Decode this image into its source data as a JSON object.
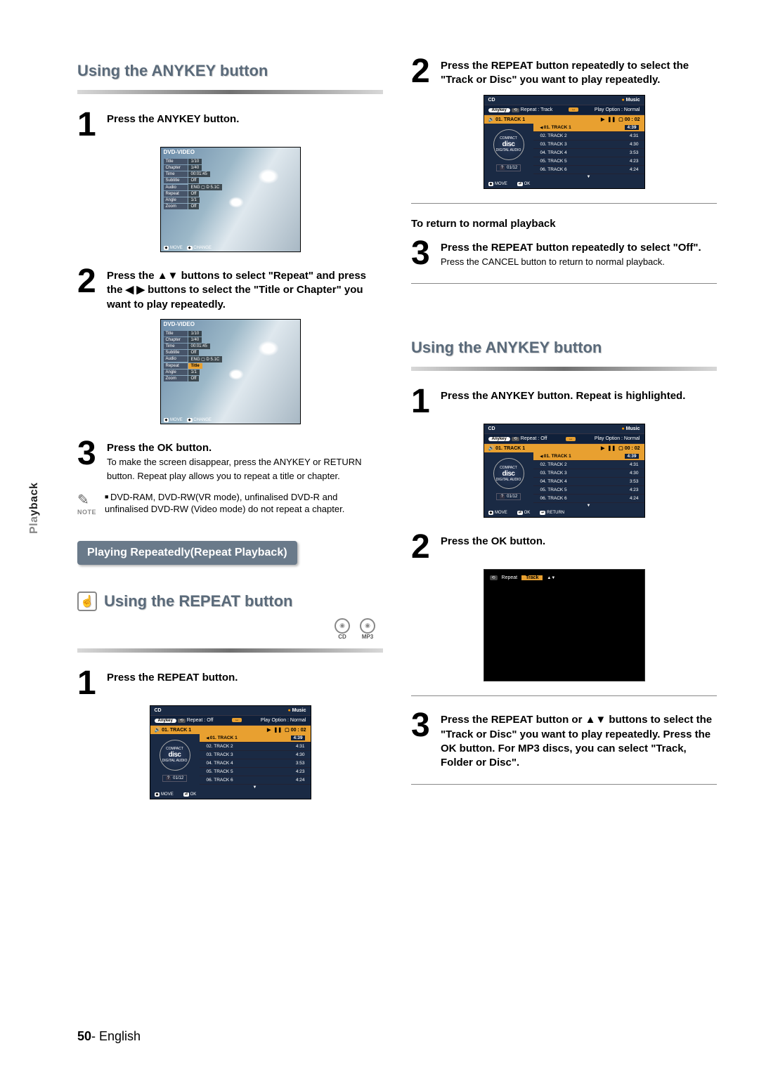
{
  "side_label_prefix": "Pla",
  "side_label_suffix": "yback",
  "page_number": "50",
  "page_lang": "English",
  "sections": {
    "anykey1": {
      "title": "Using the ANYKEY button",
      "step1": "Press the ANYKEY button.",
      "step2": "Press the ▲▼ buttons to select \"Repeat\" and press the ◀ ▶ buttons to select the \"Title or Chapter\" you want to play repeatedly.",
      "step3_bold": "Press the OK button.",
      "step3_text": "To make the screen disappear, press the ANYKEY or RETURN button. Repeat play allows you to repeat a title or chapter.",
      "note": "DVD-RAM, DVD-RW(VR mode), unfinalised DVD-R and unfinalised DVD-RW (Video mode) do not repeat a chapter.",
      "note_label": "NOTE"
    },
    "repeat_playback_heading": "Playing Repeatedly(Repeat Playback)",
    "repeat_btn": {
      "title": "Using the REPEAT button",
      "badge_cd": "CD",
      "badge_mp3": "MP3",
      "step1": "Press the REPEAT button.",
      "step2": "Press the REPEAT button repeatedly to select the \"Track or Disc\" you want to play repeatedly.",
      "return_normal": "To return to normal playback",
      "step3_bold": "Press the REPEAT button repeatedly to select \"Off\".",
      "step3_text": "Press the CANCEL button to return to normal playback."
    },
    "anykey2": {
      "title": "Using the ANYKEY button",
      "step1": "Press the ANYKEY button. Repeat is highlighted.",
      "step2": "Press the OK button.",
      "step3": "Press the REPEAT button or ▲▼ buttons to select the \"Track or Disc\" you want to play repeatedly. Press the OK button. For MP3 discs, you can select \"Track, Folder or Disc\"."
    }
  },
  "dvd_shot": {
    "caption": "DVD-VIDEO",
    "rows_a": [
      {
        "k": "Title",
        "v": "1/10"
      },
      {
        "k": "Chapter",
        "v": "1/40"
      },
      {
        "k": "Time",
        "v": "00:01:45"
      },
      {
        "k": "Subtitle",
        "v": "Off"
      },
      {
        "k": "Audio",
        "v": "ENG ▢ D 5.1C"
      },
      {
        "k": "Repeat",
        "v": "Off"
      },
      {
        "k": "Angle",
        "v": "1/1"
      },
      {
        "k": "Zoom",
        "v": "Off"
      }
    ],
    "rows_b": [
      {
        "k": "Title",
        "v": "1/10"
      },
      {
        "k": "Chapter",
        "v": "1/40"
      },
      {
        "k": "Time",
        "v": "00:01:45"
      },
      {
        "k": "Subtitle",
        "v": "Off"
      },
      {
        "k": "Audio",
        "v": "ENG ▢ D 5.1C"
      },
      {
        "k": "Repeat",
        "v": "Title",
        "hl": true
      },
      {
        "k": "Angle",
        "v": "1/1"
      },
      {
        "k": "Zoom",
        "v": "Off"
      }
    ],
    "footer_move": "MOVE",
    "footer_change": "CHANGE"
  },
  "cd_shot": {
    "cd_label": "CD",
    "music_label": "Music",
    "anykey_pill": "Anykey",
    "repeat_off": "Repeat : Off",
    "repeat_track": "Repeat : Track",
    "play_option": "Play Option : Normal",
    "now_track": "01. TRACK 1",
    "now_length": "00 : 02",
    "controls": [
      "▶",
      "❚❚",
      "▢"
    ],
    "disc_compact": "COMPACT",
    "disc_big": "disc",
    "disc_digital": "DIGITAL AUDIO",
    "time_q": "?",
    "time_val": "01/12",
    "tracks": [
      {
        "name": "01. TRACK 1",
        "time": "4:39",
        "hl": true
      },
      {
        "name": "02. TRACK 2",
        "time": "4:31"
      },
      {
        "name": "03. TRACK 3",
        "time": "4:30"
      },
      {
        "name": "04. TRACK 4",
        "time": "3:53"
      },
      {
        "name": "05. TRACK 5",
        "time": "4:23"
      },
      {
        "name": "06. TRACK 6",
        "time": "4:24"
      }
    ],
    "footer_move": "MOVE",
    "footer_ok": "OK",
    "footer_return": "RETURN"
  },
  "black_shot": {
    "repeat_label": "Repeat",
    "repeat_value": "Track"
  }
}
